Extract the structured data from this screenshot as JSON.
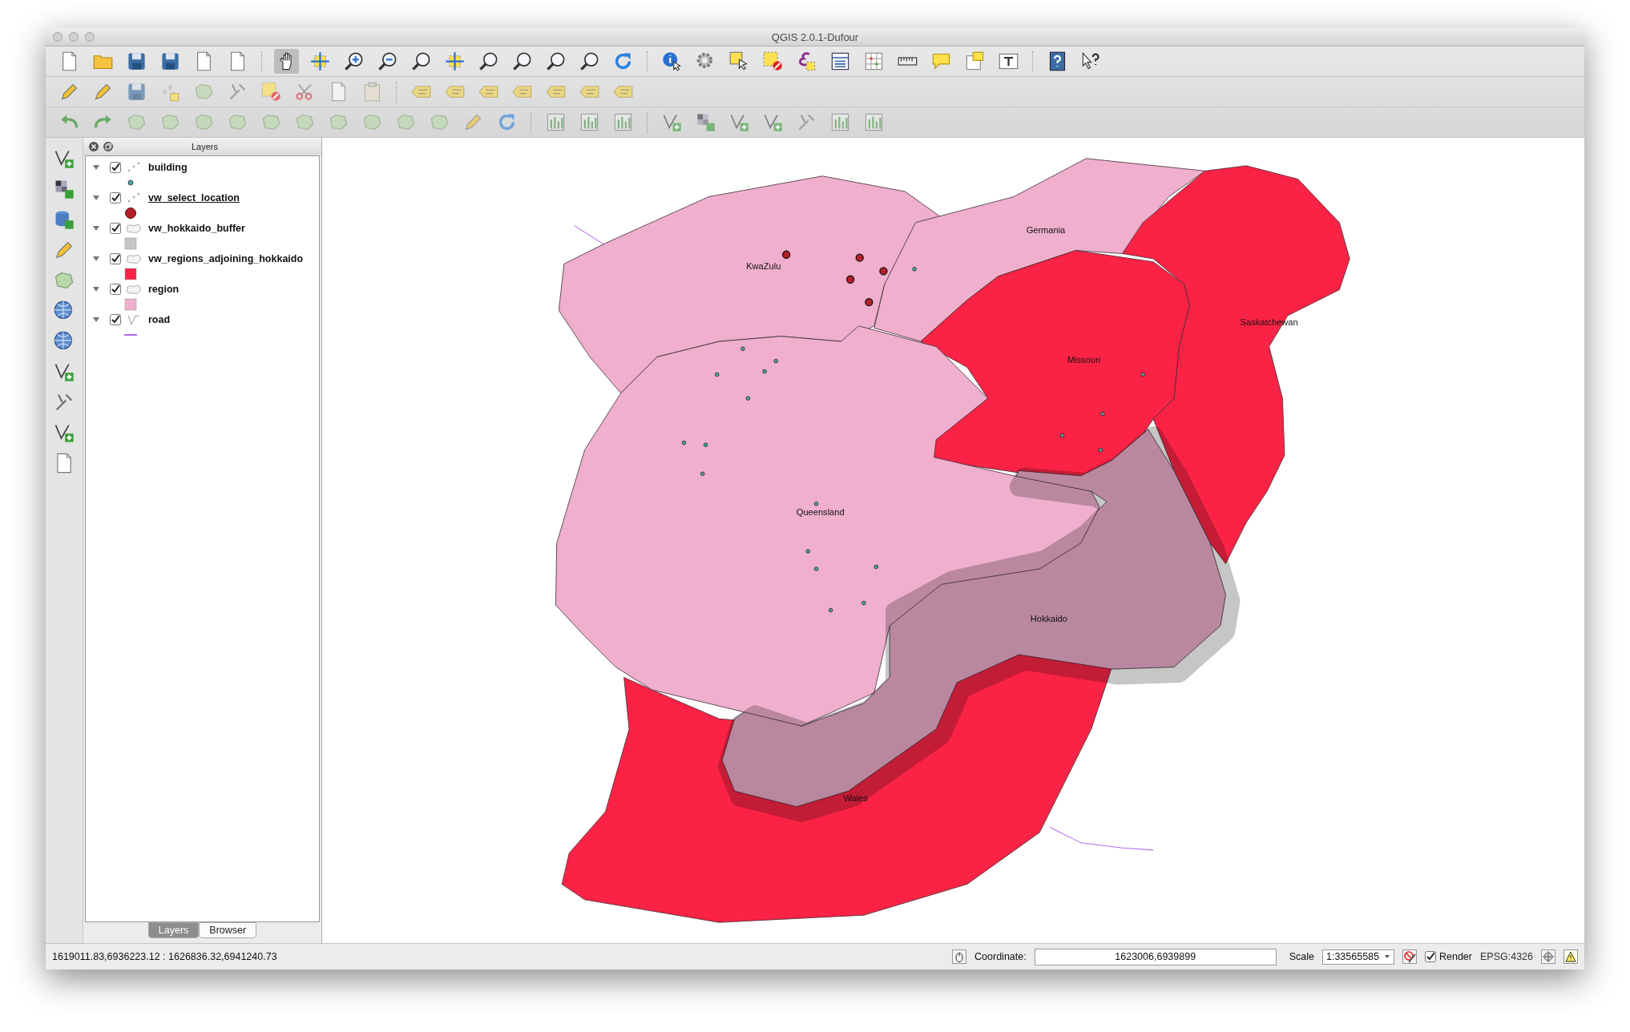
{
  "window": {
    "title": "QGIS 2.0.1-Dufour"
  },
  "layers_panel": {
    "title": "Layers",
    "layers": [
      {
        "name": "building",
        "checked": true,
        "expanded": true,
        "selected": false,
        "kind": "point",
        "color": "#4aa3a0"
      },
      {
        "name": "vw_select_location",
        "checked": true,
        "expanded": true,
        "selected": true,
        "kind": "large-point",
        "color": "#b3202a"
      },
      {
        "name": "vw_hokkaido_buffer",
        "checked": true,
        "expanded": true,
        "selected": false,
        "kind": "polygon",
        "color": "#c6c6c6"
      },
      {
        "name": "vw_regions_adjoining_hokkaido",
        "checked": true,
        "expanded": true,
        "selected": false,
        "kind": "polygon",
        "color": "#fb2345"
      },
      {
        "name": "region",
        "checked": true,
        "expanded": true,
        "selected": false,
        "kind": "polygon",
        "color": "#efafcd"
      },
      {
        "name": "road",
        "checked": true,
        "expanded": true,
        "selected": false,
        "kind": "line",
        "color": "#b36bf0"
      }
    ]
  },
  "panel_tabs": [
    {
      "label": "Layers",
      "selected": true
    },
    {
      "label": "Browser",
      "selected": false
    }
  ],
  "map": {
    "labels": [
      "Germania",
      "KwaZulu",
      "Saskatchewan",
      "Missouri",
      "Queensland",
      "Hokkaido",
      "Wales"
    ]
  },
  "status_bar": {
    "extent": "1619011.83,6936223.12 : 1626836.32,6941240.73",
    "coordinate_label": "Coordinate:",
    "coordinate": "1623006,6939899",
    "scale_label": "Scale",
    "scale": "1:33565585",
    "render": {
      "label": "Render",
      "checked": true
    },
    "crs": "EPSG:4326"
  }
}
